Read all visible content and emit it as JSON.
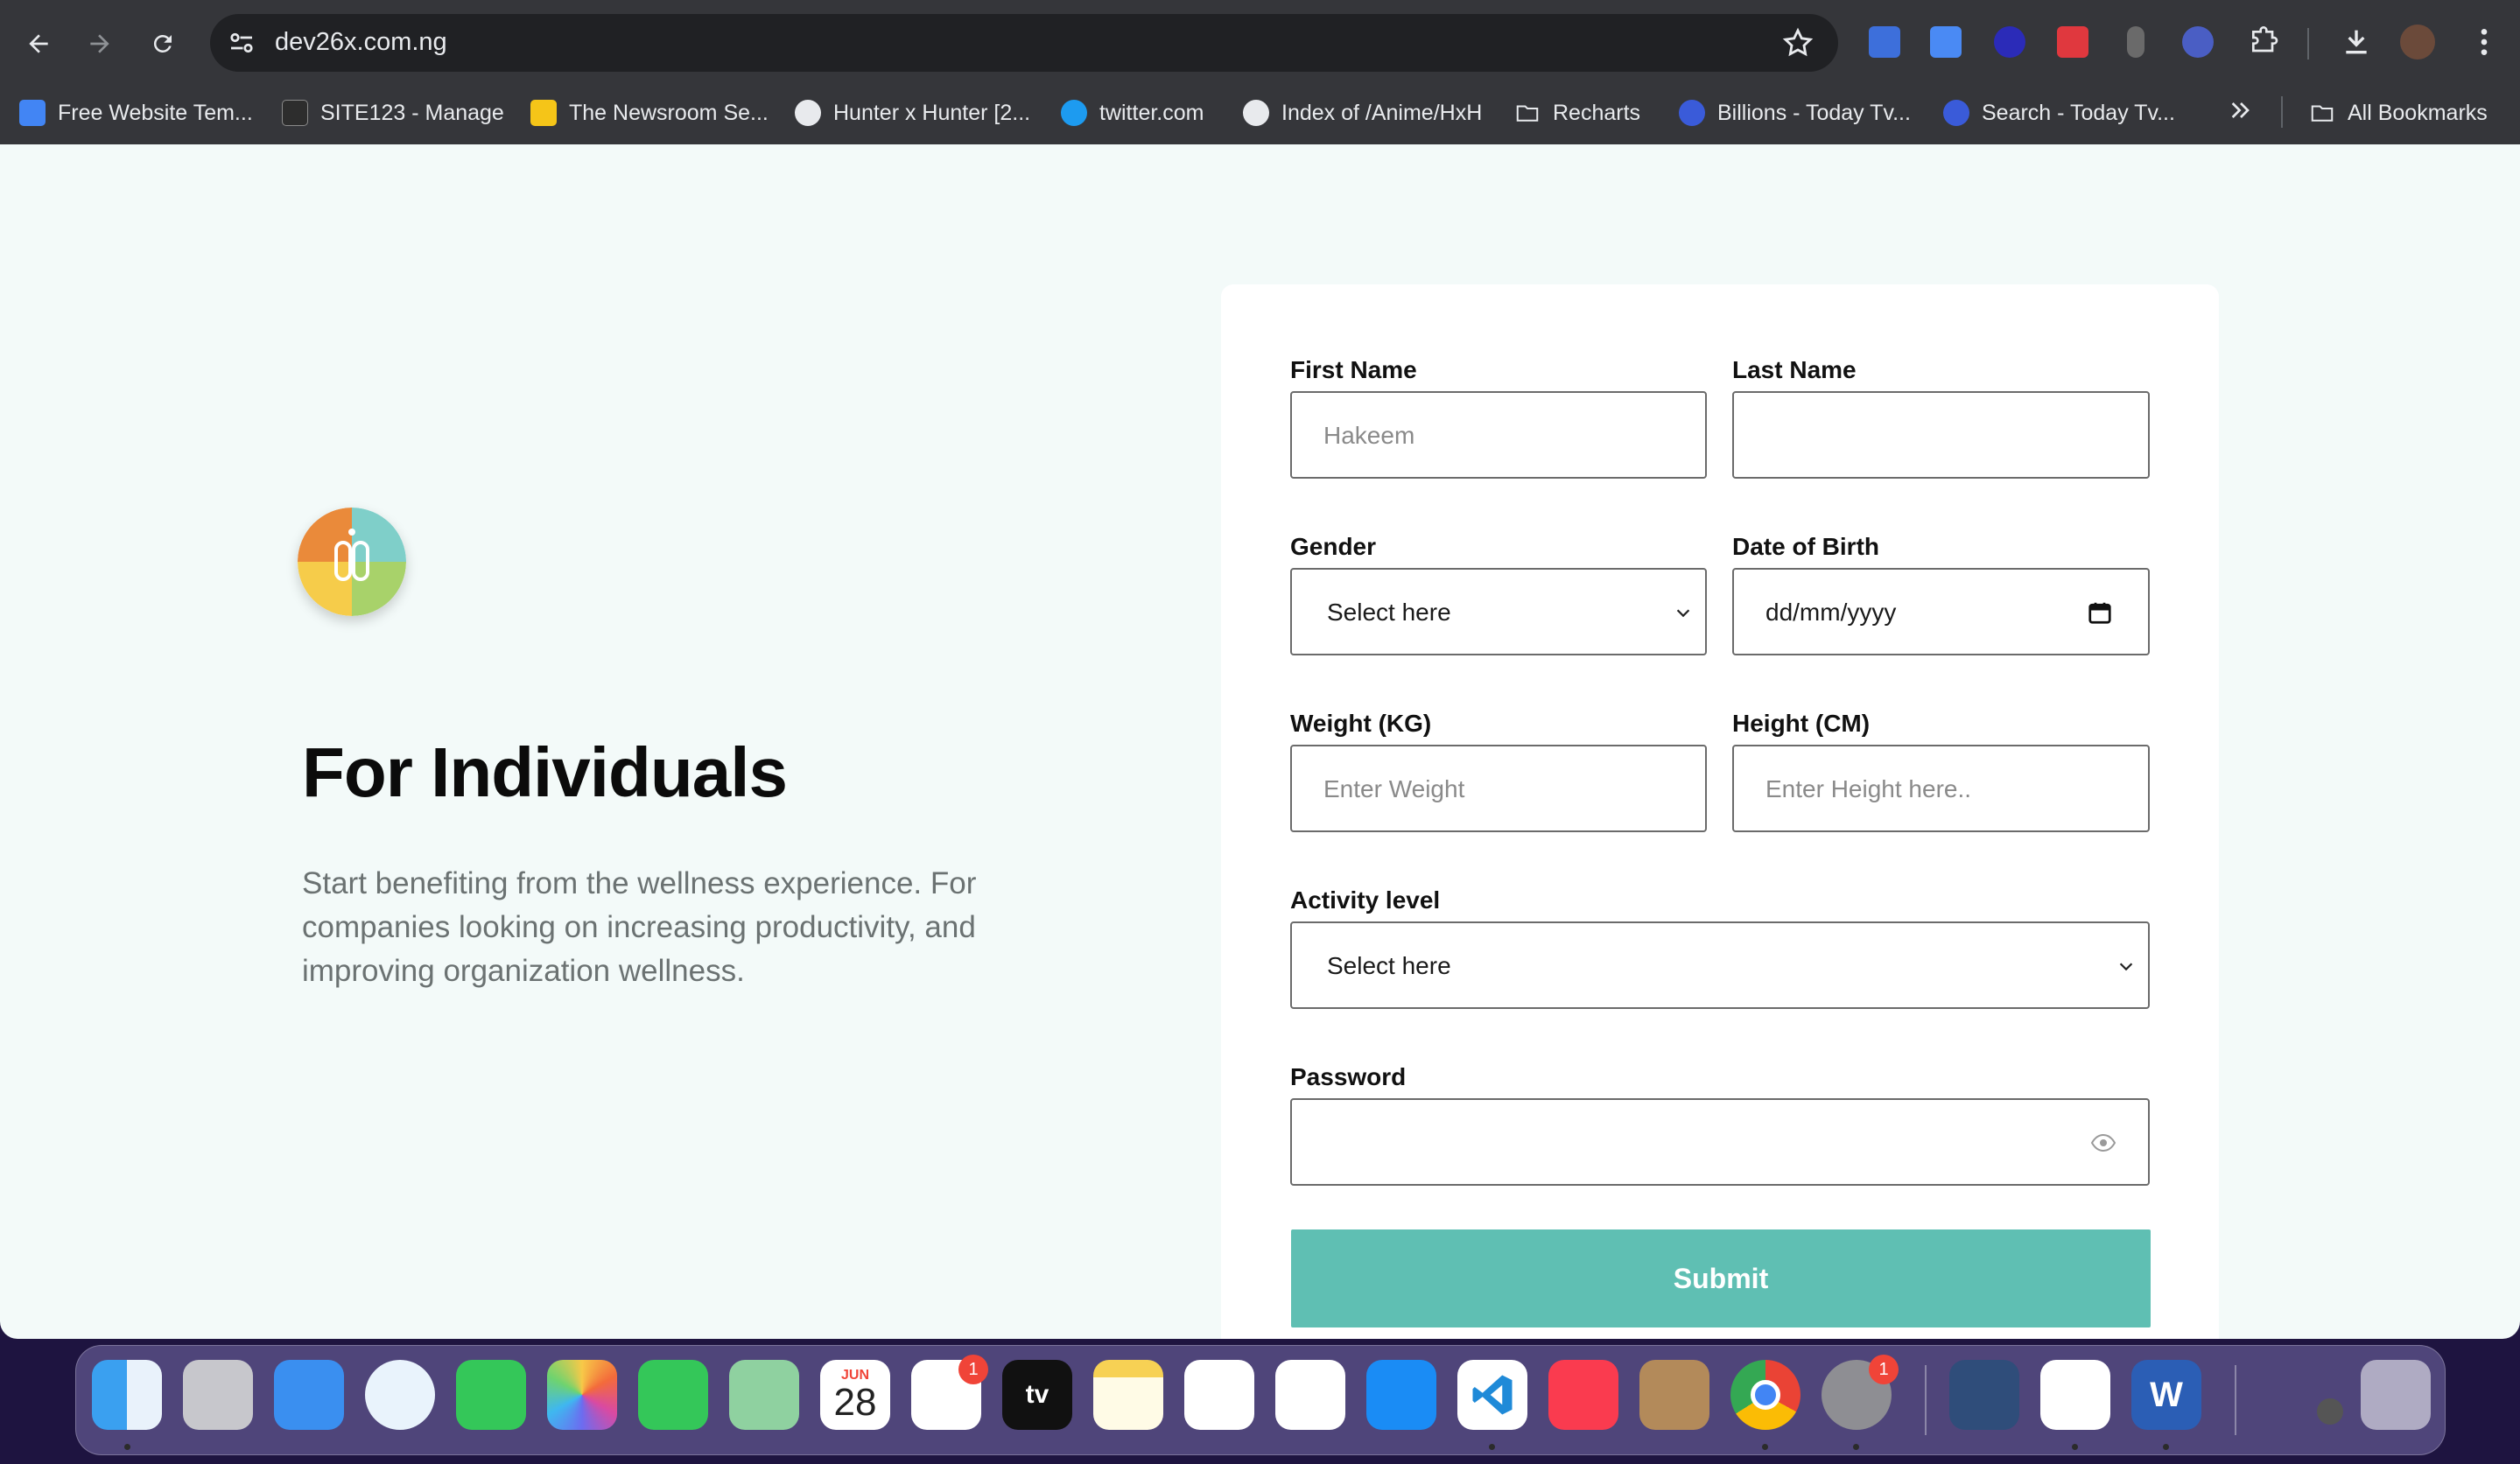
{
  "browser": {
    "url": "dev26x.com.ng",
    "bookmarks": [
      {
        "label": "Free Website Tem...",
        "icon": "docs-icon",
        "color": "#4285f4"
      },
      {
        "label": "SITE123 - Manage",
        "icon": "site123-icon",
        "color": "#2d2d2d"
      },
      {
        "label": "The Newsroom Se...",
        "icon": "newsroom-icon",
        "color": "#f5c518"
      },
      {
        "label": "Hunter x Hunter [2...",
        "icon": "globe-icon",
        "color": "#e8eaed"
      },
      {
        "label": "twitter.com",
        "icon": "twitter-icon",
        "color": "#1d9bf0"
      },
      {
        "label": "Index of /Anime/HxH",
        "icon": "globe-icon",
        "color": "#e8eaed"
      },
      {
        "label": "Recharts",
        "icon": "folder-icon",
        "color": "#e8eaed"
      },
      {
        "label": "Billions - Today Tv...",
        "icon": "todaytv-icon",
        "color": "#3a5bd9"
      },
      {
        "label": "Search - Today Tv...",
        "icon": "todaytv-icon",
        "color": "#3a5bd9"
      }
    ],
    "all_bookmarks": "All Bookmarks"
  },
  "hero": {
    "title": "For Individuals",
    "text": "Start benefiting from the wellness experience. For companies looking on increasing productivity, and improving organization wellness."
  },
  "form": {
    "first_name": {
      "label": "First Name",
      "placeholder": "Hakeem"
    },
    "last_name": {
      "label": "Last Name",
      "placeholder": ""
    },
    "gender": {
      "label": "Gender",
      "value": "Select here"
    },
    "dob": {
      "label": "Date of Birth",
      "value": "dd/mm/yyyy"
    },
    "weight": {
      "label": "Weight (KG)",
      "placeholder": "Enter Weight"
    },
    "height": {
      "label": "Height (CM)",
      "placeholder": "Enter Height here.."
    },
    "activity": {
      "label": "Activity level",
      "value": "Select here"
    },
    "password": {
      "label": "Password",
      "placeholder": ""
    },
    "submit": "Submit",
    "accent": "#5fbfb3"
  },
  "dock": {
    "apps": [
      "Finder",
      "Launchpad",
      "Mail",
      "Safari",
      "Messages",
      "Photos",
      "FaceTime",
      "Maps",
      "Calendar",
      "Reminders",
      "TV",
      "Notes",
      "Freeform",
      "News",
      "App Store",
      "Visual Studio Code",
      "Music",
      "Contacts",
      "Chrome",
      "System Settings",
      "Migration",
      "Slack",
      "Word",
      "Trash"
    ],
    "calendar_month": "JUN",
    "calendar_day": "28",
    "reminders_badge": "1",
    "settings_badge": "1"
  }
}
